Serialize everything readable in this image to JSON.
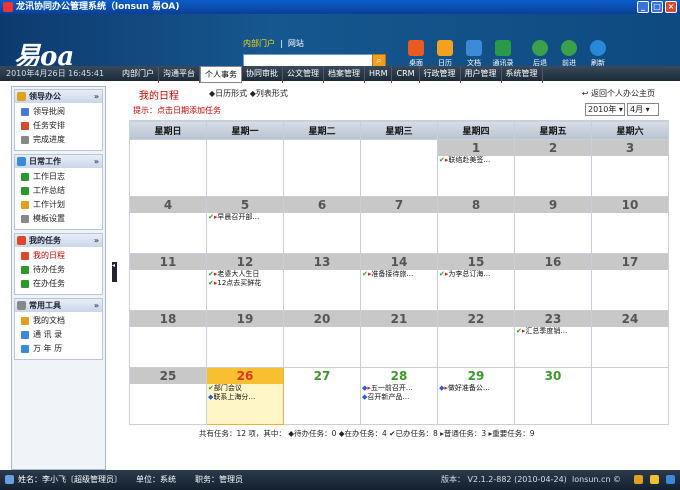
{
  "window": {
    "title": "龙讯协同办公管理系统（lonsun 易OA)"
  },
  "header": {
    "logo": "易oa",
    "portal_tabs": [
      "内部门户",
      "网站"
    ],
    "search_icon": "search-icon",
    "tools": [
      {
        "label": "桌面",
        "color": "#e85a20"
      },
      {
        "label": "日历",
        "color": "#f4a020"
      },
      {
        "label": "文档",
        "color": "#3a8ad8"
      },
      {
        "label": "通讯录",
        "color": "#2a9a4a"
      }
    ],
    "nav": [
      {
        "label": "后退",
        "color": "#3aa04a"
      },
      {
        "label": "前进",
        "color": "#3aa04a"
      },
      {
        "label": "刷新",
        "color": "#2a88d8"
      }
    ]
  },
  "menubar": {
    "date": "2010年4月26日 16:45:41",
    "items": [
      "内部门户",
      "沟通平台",
      "个人事务",
      "协同审批",
      "公文管理",
      "档案管理",
      "HRM",
      "CRM",
      "行政管理",
      "用户管理",
      "系统管理"
    ],
    "active_index": 2
  },
  "sidebar": {
    "groups": [
      {
        "title": "领导办公",
        "color": "#e0a020",
        "items": [
          {
            "label": "领导批阅",
            "color": "#4a7ad8"
          },
          {
            "label": "任务安排",
            "color": "#d84a2a"
          },
          {
            "label": "完成进度",
            "color": "#888"
          }
        ]
      },
      {
        "title": "日常工作",
        "color": "#3a8ad8",
        "items": [
          {
            "label": "工作日志",
            "color": "#2a9a2a"
          },
          {
            "label": "工作总结",
            "color": "#2a9a2a"
          },
          {
            "label": "工作计划",
            "color": "#e0a020"
          },
          {
            "label": "模板设置",
            "color": "#888"
          }
        ]
      },
      {
        "title": "我的任务",
        "color": "#d84a2a",
        "items": [
          {
            "label": "我的日程",
            "color": "#d84a2a",
            "selected": true
          },
          {
            "label": "待办任务",
            "color": "#2a9a2a"
          },
          {
            "label": "在办任务",
            "color": "#2a9a2a"
          }
        ]
      },
      {
        "title": "常用工具",
        "color": "#888",
        "items": [
          {
            "label": "我的文档",
            "color": "#e0a020"
          },
          {
            "label": "通 讯 录",
            "color": "#3a8ad8"
          },
          {
            "label": "万 年 历",
            "color": "#3a8ad8"
          }
        ]
      }
    ]
  },
  "main": {
    "title": "我的日程",
    "views": "◆日历形式 ◆列表形式",
    "back": "返回个人办公主页",
    "hint": "提示：点击日期添加任务",
    "year": "2010年",
    "month": "4月",
    "weekdays": [
      "星期日",
      "星期一",
      "星期二",
      "星期三",
      "星期四",
      "星期五",
      "星期六"
    ],
    "weeks": [
      [
        {
          "d": ""
        },
        {
          "d": ""
        },
        {
          "d": ""
        },
        {
          "d": ""
        },
        {
          "d": "1",
          "ev": [
            {
              "i": "ck fl",
              "t": "联络赴美签…"
            }
          ]
        },
        {
          "d": "2"
        },
        {
          "d": "3"
        }
      ],
      [
        {
          "d": "4"
        },
        {
          "d": "5",
          "ev": [
            {
              "i": "ck fl",
              "t": "早晨召开部…"
            }
          ]
        },
        {
          "d": "6"
        },
        {
          "d": "7"
        },
        {
          "d": "8"
        },
        {
          "d": "9"
        },
        {
          "d": "10"
        }
      ],
      [
        {
          "d": "11"
        },
        {
          "d": "12",
          "ev": [
            {
              "i": "ck fl",
              "t": "老婆大人生日"
            },
            {
              "i": "ck fl",
              "t": "12点去买鲜花"
            }
          ]
        },
        {
          "d": "13"
        },
        {
          "d": "14",
          "ev": [
            {
              "i": "ck fl",
              "t": "准备接待旅…"
            }
          ]
        },
        {
          "d": "15",
          "ev": [
            {
              "i": "ck fl",
              "t": "为李总订海…"
            }
          ]
        },
        {
          "d": "16"
        },
        {
          "d": "17"
        }
      ],
      [
        {
          "d": "18"
        },
        {
          "d": "19"
        },
        {
          "d": "20"
        },
        {
          "d": "21"
        },
        {
          "d": "22"
        },
        {
          "d": "23",
          "ev": [
            {
              "i": "ck fl",
              "t": "汇总季度销…"
            }
          ]
        },
        {
          "d": "24"
        }
      ],
      [
        {
          "d": "25"
        },
        {
          "d": "26",
          "today": true,
          "ev": [
            {
              "i": "ck",
              "t": "部门会议"
            },
            {
              "i": "dia",
              "t": "联系上海分…"
            }
          ]
        },
        {
          "d": "27",
          "next": true
        },
        {
          "d": "28",
          "next": true,
          "ev": [
            {
              "i": "dia fl",
              "t": "五一前召开…"
            },
            {
              "i": "dia",
              "t": "召开新产品…"
            }
          ]
        },
        {
          "d": "29",
          "next": true,
          "ev": [
            {
              "i": "dia fl",
              "t": "做好准备公…"
            }
          ]
        },
        {
          "d": "30",
          "next": true
        },
        {
          "d": ""
        }
      ]
    ],
    "footer": "共有任务：12 项，其中： ◆待办任务：0 ◆在办任务：4 ✔已办任务：8 ▸普通任务：3 ▸重要任务：9"
  },
  "status": {
    "user": "姓名：李小飞〔超级管理员〕",
    "dept": "单位：系统",
    "post": "职务：管理员",
    "version": "版本： V2.1.2-882 (2010-04-24)",
    "site": "lonsun.cn ©"
  }
}
